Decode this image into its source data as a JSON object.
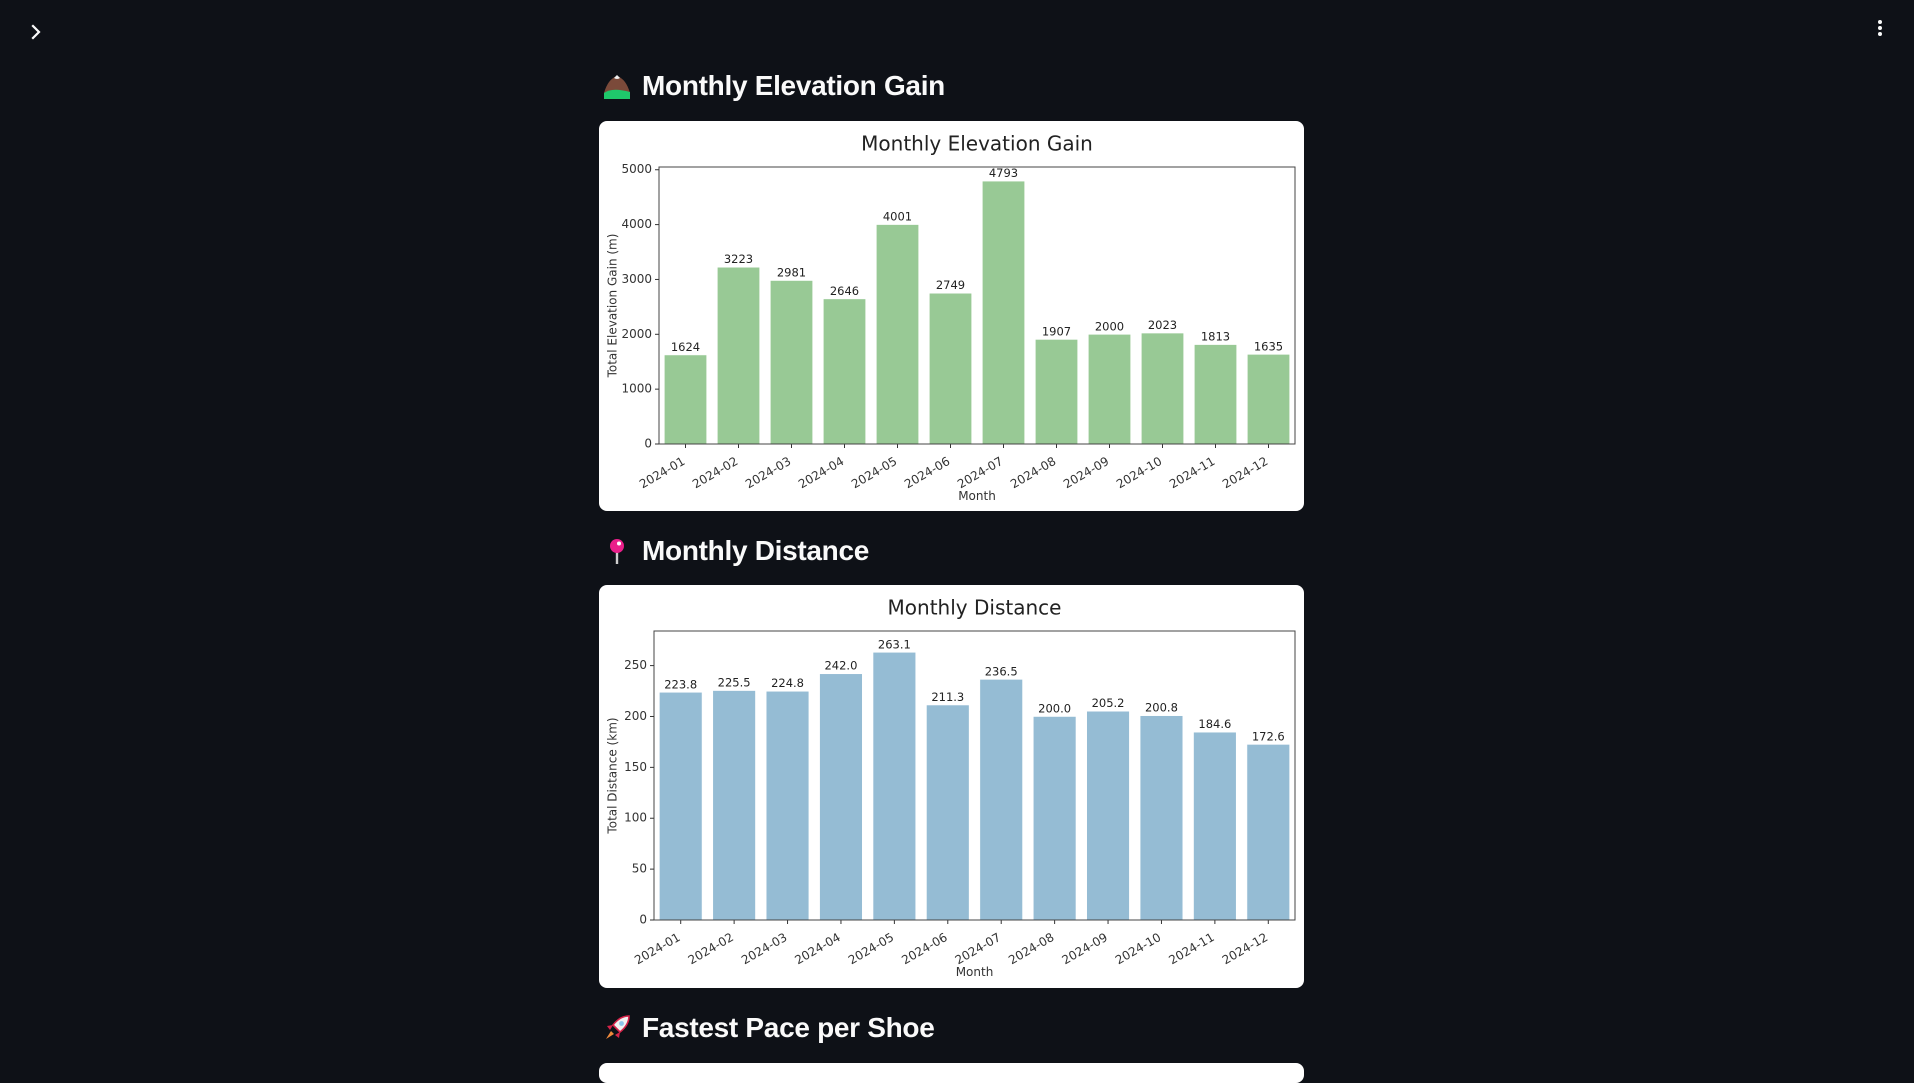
{
  "app": {
    "sidebar_toggle_icon": "chevron-right-icon",
    "menu_icon": "vertical-ellipsis-icon"
  },
  "sections": [
    {
      "icon": "mountain-icon",
      "title": "Monthly Elevation Gain"
    },
    {
      "icon": "round-pushpin-icon",
      "title": "Monthly Distance"
    },
    {
      "icon": "rocket-icon",
      "title": "Fastest Pace per Shoe"
    }
  ],
  "chart_data": [
    {
      "type": "bar",
      "title": "Monthly Elevation Gain",
      "xlabel": "Month",
      "ylabel": "Total Elevation Gain (m)",
      "categories": [
        "2024-01",
        "2024-02",
        "2024-03",
        "2024-04",
        "2024-05",
        "2024-06",
        "2024-07",
        "2024-08",
        "2024-09",
        "2024-10",
        "2024-11",
        "2024-12"
      ],
      "values": [
        1624,
        3223,
        2981,
        2646,
        4001,
        2749,
        4793,
        1907,
        2000,
        2023,
        1813,
        1635
      ],
      "value_labels": [
        "1624",
        "3223",
        "2981",
        "2646",
        "4001",
        "2749",
        "4793",
        "1907",
        "2000",
        "2023",
        "1813",
        "1635"
      ],
      "ylim": [
        0,
        5050
      ],
      "yticks": [
        0,
        1000,
        2000,
        3000,
        4000,
        5000
      ],
      "color": "#98c995",
      "grid": false
    },
    {
      "type": "bar",
      "title": "Monthly Distance",
      "xlabel": "Month",
      "ylabel": "Total Distance (km)",
      "categories": [
        "2024-01",
        "2024-02",
        "2024-03",
        "2024-04",
        "2024-05",
        "2024-06",
        "2024-07",
        "2024-08",
        "2024-09",
        "2024-10",
        "2024-11",
        "2024-12"
      ],
      "values": [
        223.8,
        225.5,
        224.8,
        242.0,
        263.1,
        211.3,
        236.5,
        200.0,
        205.2,
        200.8,
        184.6,
        172.6
      ],
      "value_labels": [
        "223.8",
        "225.5",
        "224.8",
        "242.0",
        "263.1",
        "211.3",
        "236.5",
        "200.0",
        "205.2",
        "200.8",
        "184.6",
        "172.6"
      ],
      "ylim": [
        0,
        284
      ],
      "yticks": [
        0,
        50,
        100,
        150,
        200,
        250
      ],
      "color": "#95bcd4",
      "grid": false
    }
  ]
}
